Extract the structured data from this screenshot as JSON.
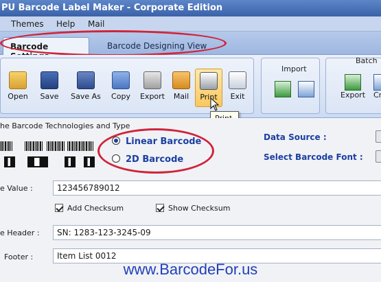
{
  "window": {
    "title": "PU Barcode Label Maker - Corporate Edition"
  },
  "menu": [
    "Themes",
    "Help",
    "Mail"
  ],
  "tabs": [
    {
      "label": "Barcode Settings",
      "active": true
    },
    {
      "label": "Barcode Designing View",
      "active": false
    }
  ],
  "toolbar": {
    "buttons": [
      {
        "label": "Open",
        "icon": "open-folder-icon"
      },
      {
        "label": "Save",
        "icon": "save-icon"
      },
      {
        "label": "Save As",
        "icon": "save-as-icon"
      },
      {
        "label": "Copy",
        "icon": "copy-icon"
      },
      {
        "label": "Export",
        "icon": "export-icon"
      },
      {
        "label": "Mail",
        "icon": "mail-icon"
      },
      {
        "label": "Print",
        "icon": "print-icon",
        "pressed": true
      },
      {
        "label": "Exit",
        "icon": "exit-icon"
      }
    ],
    "tooltip": "Print",
    "import_group": {
      "title": "Import"
    },
    "batch_group": {
      "title": "Batch",
      "export_label": "Export",
      "cut_label": "Cr"
    }
  },
  "barcode_settings": {
    "section_label": "he Barcode Technologies and Type",
    "linear_label": "Linear Barcode",
    "twod_label": "2D Barcode",
    "selected": "Linear Barcode",
    "data_source_label": "Data Source :",
    "font_label": "Select Barcode Font :"
  },
  "fields": {
    "value_label": "e Value :",
    "value": "123456789012",
    "add_checksum_label": "Add Checksum",
    "add_checksum": true,
    "show_checksum_label": "Show Checksum",
    "show_checksum": true,
    "header_label": "e Header :",
    "header": "SN: 1283-123-3245-09",
    "footer_label": "Footer :",
    "footer": "Item List 0012"
  },
  "watermark": "www.BarcodeFor.us",
  "colors": {
    "accent": "#1b3fa0",
    "highlight_ellipse": "#d0243a",
    "print_pressed": "#f8c860"
  }
}
